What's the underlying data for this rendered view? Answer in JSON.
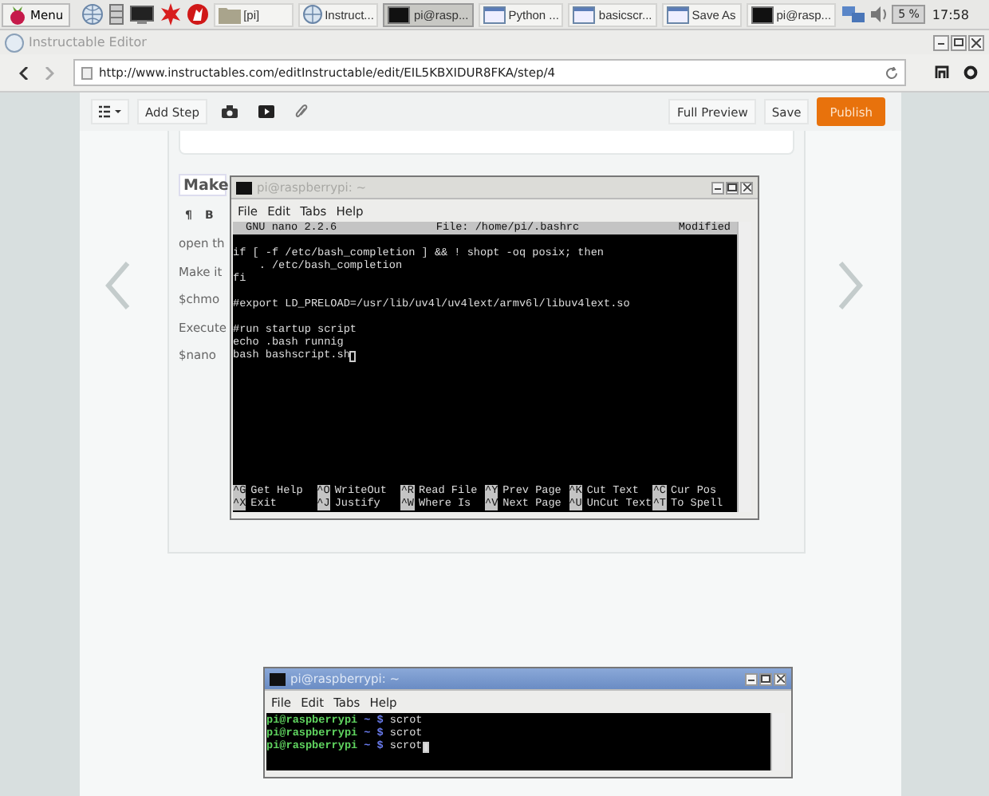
{
  "taskbar": {
    "menu_label": "Menu",
    "tasks": [
      {
        "kind": "folder",
        "label": "[pi]",
        "selected": false
      },
      {
        "kind": "browser",
        "label": "Instruct...",
        "selected": false
      },
      {
        "kind": "terminal",
        "label": "pi@rasp...",
        "selected": true
      },
      {
        "kind": "window",
        "label": "Python ...",
        "selected": false
      },
      {
        "kind": "window",
        "label": "basicscr...",
        "selected": false
      },
      {
        "kind": "window",
        "label": "Save As",
        "selected": false
      },
      {
        "kind": "terminal",
        "label": "pi@rasp...",
        "selected": false
      }
    ],
    "cpu": "5 %",
    "clock": "17:58"
  },
  "browser": {
    "title": "Instructable Editor",
    "url": "http://www.instructables.com/editInstructable/edit/EIL5KBXIDUR8FKA/step/4",
    "toolbar": {
      "add_step": "Add Step",
      "full_preview": "Full Preview",
      "save": "Save",
      "publish": "Publish"
    },
    "card": {
      "heading": "Make",
      "format_buttons": [
        "¶",
        "B"
      ],
      "lines": [
        "open th",
        "Make it",
        "$chmo",
        "Execute",
        "$nano"
      ]
    }
  },
  "terminals": [
    {
      "title": "pi@raspberrypi: ~",
      "active": false,
      "menu": [
        "File",
        "Edit",
        "Tabs",
        "Help"
      ],
      "nano": {
        "version": "GNU nano 2.2.6",
        "file": "File: /home/pi/.bashrc",
        "status": "Modified",
        "blocks": [
          [
            "if [ -f /etc/bash_completion ] && ! shopt -oq posix; then",
            "    . /etc/bash_completion",
            "fi"
          ],
          [
            "#export LD_PRELOAD=/usr/lib/uv4l/uv4lext/armv6l/libuv4lext.so"
          ],
          [
            "#run startup script",
            "echo .bash runnig",
            "bash bashscript.sh"
          ]
        ],
        "shortcuts": [
          {
            "key": "^G",
            "label": "Get Help"
          },
          {
            "key": "^O",
            "label": "WriteOut"
          },
          {
            "key": "^R",
            "label": "Read File"
          },
          {
            "key": "^Y",
            "label": "Prev Page"
          },
          {
            "key": "^K",
            "label": "Cut Text"
          },
          {
            "key": "^C",
            "label": "Cur Pos"
          },
          {
            "key": "^X",
            "label": "Exit"
          },
          {
            "key": "^J",
            "label": "Justify"
          },
          {
            "key": "^W",
            "label": "Where Is"
          },
          {
            "key": "^V",
            "label": "Next Page"
          },
          {
            "key": "^U",
            "label": "UnCut Text"
          },
          {
            "key": "^T",
            "label": "To Spell"
          }
        ]
      }
    },
    {
      "title": "pi@raspberrypi: ~",
      "active": true,
      "menu": [
        "File",
        "Edit",
        "Tabs",
        "Help"
      ],
      "lines": [
        {
          "user": "pi@raspberrypi",
          "path": "~ $",
          "command": "scrot"
        },
        {
          "user": "pi@raspberrypi",
          "path": "~ $",
          "command": "scrot"
        },
        {
          "user": "pi@raspberrypi",
          "path": "~ $",
          "command": "scrot"
        }
      ]
    }
  ]
}
